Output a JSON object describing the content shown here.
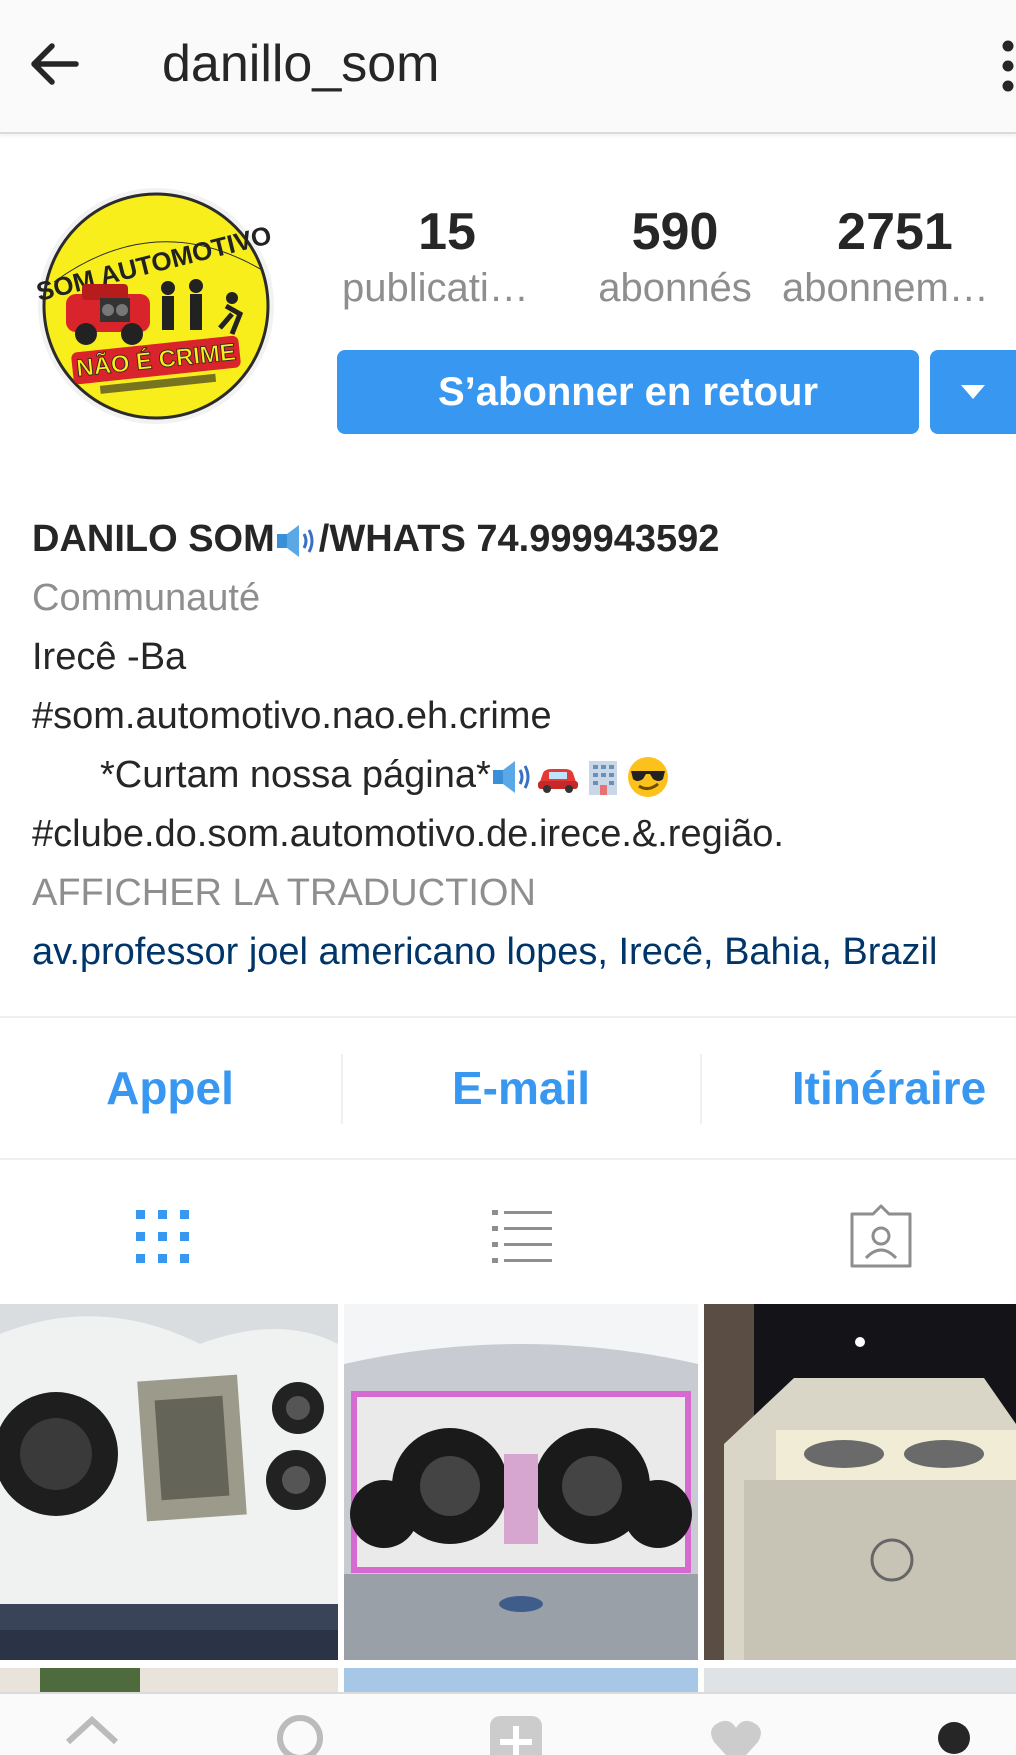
{
  "header": {
    "username": "danillo_som",
    "back_icon": "arrow-left-icon",
    "menu_icon": "kebab-menu-icon"
  },
  "profile": {
    "avatar_text_top": "SOM AUTOMOTIVO",
    "avatar_text_bottom": "NÃO É CRIME",
    "stats": [
      {
        "value": "15",
        "label": "publications"
      },
      {
        "value": "590",
        "label": "abonnés"
      },
      {
        "value": "2751",
        "label": "abonnements"
      }
    ],
    "follow_back_label": "S’abonner en retour",
    "accent": "#3897f0"
  },
  "bio": {
    "name": "DANILO SOM",
    "name_suffix": "/WHATS 74.999943592",
    "category": "Communauté",
    "line1": "Irecê -Ba",
    "line2": "#som.automotivo.nao.eh.crime",
    "line3": "*Curtam nossa página*",
    "line4": "#clube.do.som.automotivo.de.irece.&.região.",
    "translate_label": "AFFICHER LA TRADUCTION",
    "address": "av.professor joel americano lopes, Irecê, Bahia, Brazil"
  },
  "contact": {
    "call_label": "Appel",
    "email_label": "E-mail",
    "directions_label": "Itinéraire"
  },
  "tabs": [
    "grid-icon",
    "list-icon",
    "tagged-icon"
  ],
  "bottom_nav": [
    "home-icon",
    "search-icon",
    "add-icon",
    "heart-icon",
    "profile-icon"
  ]
}
